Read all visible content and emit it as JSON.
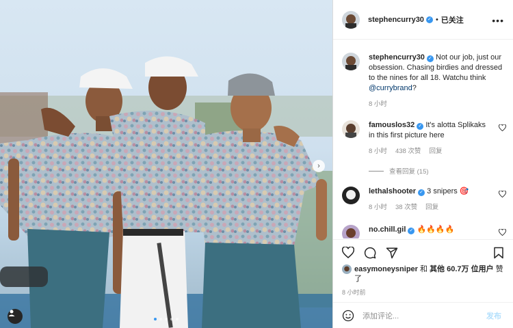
{
  "post": {
    "author": "stephencurry30",
    "follow_separator": "•",
    "follow_state": "已关注",
    "more": "•••",
    "caption": {
      "user": "stephencurry30",
      "text": "Not our job, just our obsession. Chasing birdies and dressed to the nines for all 18. Watchu think ",
      "mention": "@currybrand",
      "tail": "?",
      "time": "8 小时"
    }
  },
  "comments": [
    {
      "user": "famouslos32",
      "text": "It's alotta Splikaks in this first picture here",
      "time": "8 小时",
      "likes": "438 次赞",
      "reply": "回复",
      "view_replies": "查看回复 (15)"
    },
    {
      "user": "lethalshooter",
      "text": "3 snipers 🎯",
      "time": "8 小时",
      "likes": "38 次赞",
      "reply": "回复"
    },
    {
      "user": "no.chill.gil",
      "text": "🔥🔥🔥🔥"
    }
  ],
  "likes": {
    "user": "easymoneysniper",
    "connector": "和",
    "others": "其他 60.7万 位用户",
    "suffix": "赞了"
  },
  "timestamp": "8 小时前",
  "composer": {
    "placeholder": "添加评论...",
    "post_label": "发布"
  },
  "carousel": {
    "slides": 5,
    "active": 1
  },
  "colors": {
    "accent": "#3897f0",
    "link": "#00376b",
    "muted": "#8e8e8e",
    "post_disabled": "#b2dffc"
  }
}
